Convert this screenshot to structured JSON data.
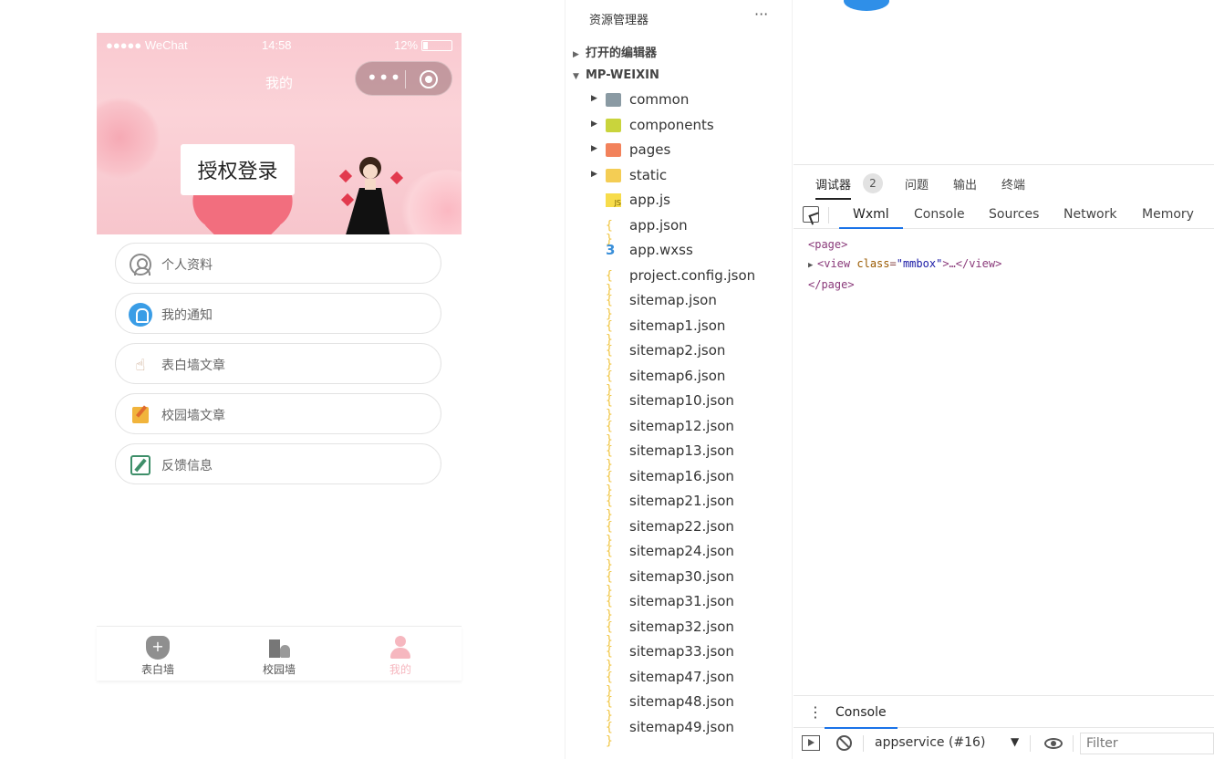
{
  "simulator": {
    "status_bar": {
      "carrier": "●●●●● WeChat",
      "time": "14:58",
      "battery": "12%"
    },
    "nav_title": "我的",
    "login_button": "授权登录",
    "menu": [
      {
        "label": "个人资料",
        "icon": "user-icon"
      },
      {
        "label": "我的通知",
        "icon": "bell-icon"
      },
      {
        "label": "表白墙文章",
        "icon": "hand-icon"
      },
      {
        "label": "校园墙文章",
        "icon": "edit-icon"
      },
      {
        "label": "反馈信息",
        "icon": "note-edit-icon"
      }
    ],
    "tabbar": [
      {
        "label": "表白墙",
        "icon": "shield-plus-icon",
        "active": false
      },
      {
        "label": "校园墙",
        "icon": "campus-icon",
        "active": false
      },
      {
        "label": "我的",
        "icon": "person-icon",
        "active": true
      }
    ]
  },
  "explorer": {
    "title": "资源管理器",
    "open_editors": "打开的编辑器",
    "project": "MP-WEIXIN",
    "items": [
      {
        "name": "common",
        "type": "folder",
        "color": "#8a9aa3"
      },
      {
        "name": "components",
        "type": "folder",
        "color": "#c9d43c"
      },
      {
        "name": "pages",
        "type": "folder",
        "color": "#f2825b"
      },
      {
        "name": "static",
        "type": "folder",
        "color": "#f4cd54"
      },
      {
        "name": "app.js",
        "type": "js"
      },
      {
        "name": "app.json",
        "type": "json"
      },
      {
        "name": "app.wxss",
        "type": "css"
      },
      {
        "name": "project.config.json",
        "type": "json"
      },
      {
        "name": "sitemap.json",
        "type": "json"
      },
      {
        "name": "sitemap1.json",
        "type": "json"
      },
      {
        "name": "sitemap2.json",
        "type": "json"
      },
      {
        "name": "sitemap6.json",
        "type": "json"
      },
      {
        "name": "sitemap10.json",
        "type": "json"
      },
      {
        "name": "sitemap12.json",
        "type": "json"
      },
      {
        "name": "sitemap13.json",
        "type": "json"
      },
      {
        "name": "sitemap16.json",
        "type": "json"
      },
      {
        "name": "sitemap21.json",
        "type": "json"
      },
      {
        "name": "sitemap22.json",
        "type": "json"
      },
      {
        "name": "sitemap24.json",
        "type": "json"
      },
      {
        "name": "sitemap30.json",
        "type": "json"
      },
      {
        "name": "sitemap31.json",
        "type": "json"
      },
      {
        "name": "sitemap32.json",
        "type": "json"
      },
      {
        "name": "sitemap33.json",
        "type": "json"
      },
      {
        "name": "sitemap47.json",
        "type": "json"
      },
      {
        "name": "sitemap48.json",
        "type": "json"
      },
      {
        "name": "sitemap49.json",
        "type": "json"
      }
    ]
  },
  "devtools": {
    "top_tabs": [
      {
        "label": "调试器",
        "active": true
      },
      {
        "label": "问题",
        "active": false
      },
      {
        "label": "输出",
        "active": false
      },
      {
        "label": "终端",
        "active": false
      }
    ],
    "badge": "2",
    "tabs": [
      {
        "label": "Wxml",
        "active": true
      },
      {
        "label": "Console",
        "active": false
      },
      {
        "label": "Sources",
        "active": false
      },
      {
        "label": "Network",
        "active": false
      },
      {
        "label": "Memory",
        "active": false
      }
    ],
    "wxml": {
      "open_tag": "<page>",
      "child_tag": "view",
      "child_attr": "class",
      "child_value": "\"mmbox\"",
      "child_close": ">…</view>",
      "close_tag": "</page>"
    },
    "console_tab": "Console",
    "context": "appservice (#16)",
    "filter_placeholder": "Filter"
  }
}
